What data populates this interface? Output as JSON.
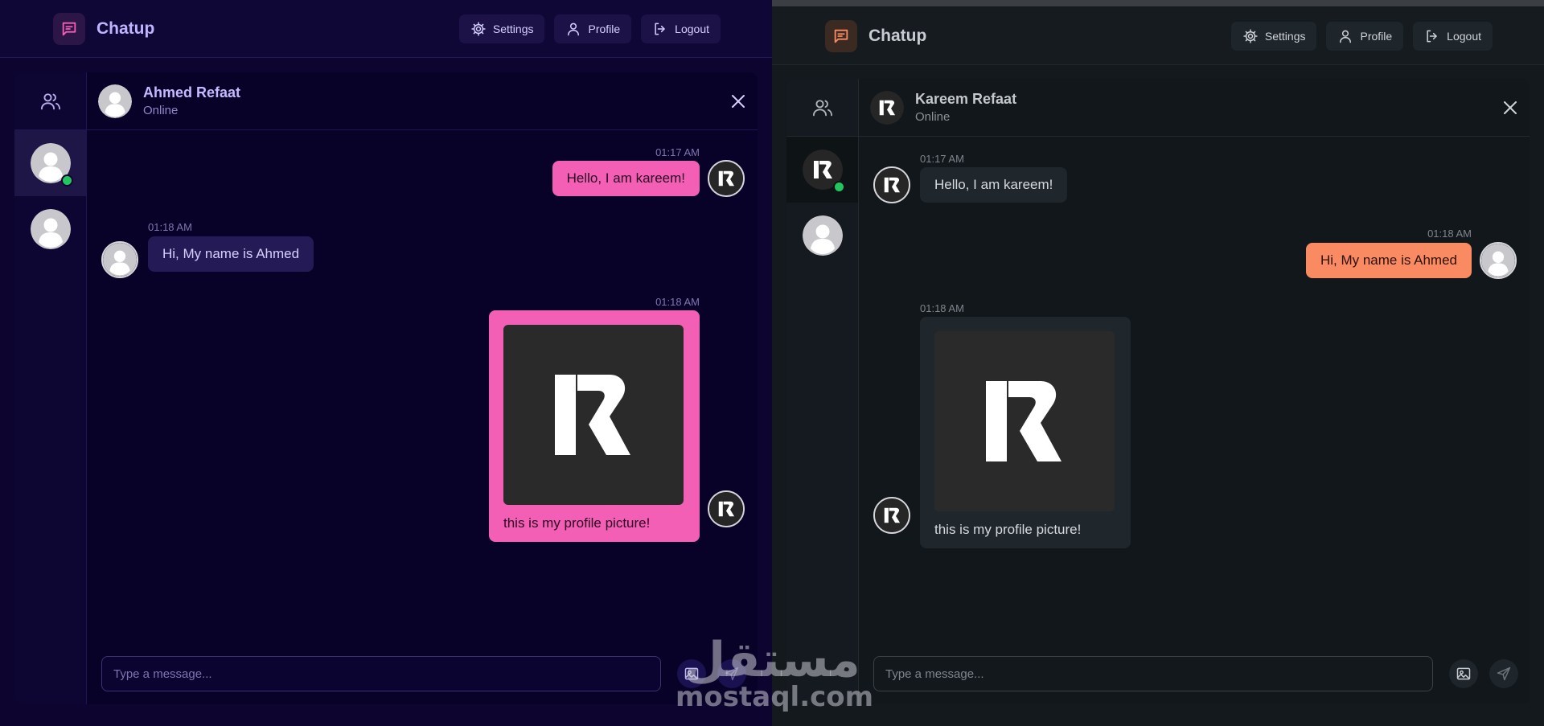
{
  "brand": {
    "title": "Chatup"
  },
  "nav": {
    "settings": "Settings",
    "profile": "Profile",
    "logout": "Logout"
  },
  "composer": {
    "placeholder": "Type a message..."
  },
  "left": {
    "header": {
      "name": "Ahmed Refaat",
      "status": "Online"
    },
    "messages": [
      {
        "time": "01:17 AM",
        "text": "Hello, I am kareem!"
      },
      {
        "time": "01:18 AM",
        "text": "Hi, My name is Ahmed"
      },
      {
        "time": "01:18 AM",
        "text": "this is my profile picture!"
      }
    ]
  },
  "right": {
    "header": {
      "name": "Kareem Refaat",
      "status": "Online"
    },
    "messages": [
      {
        "time": "01:17 AM",
        "text": "Hello, I am kareem!"
      },
      {
        "time": "01:18 AM",
        "text": "Hi, My name is Ahmed"
      },
      {
        "time": "01:18 AM",
        "text": "this is my profile picture!"
      }
    ]
  },
  "watermark": {
    "arabic": "مستقل",
    "latin": "mostaql.com"
  },
  "colors": {
    "left_accent": "#f25fb5",
    "right_accent": "#fa8a62",
    "online": "#22c55e"
  }
}
